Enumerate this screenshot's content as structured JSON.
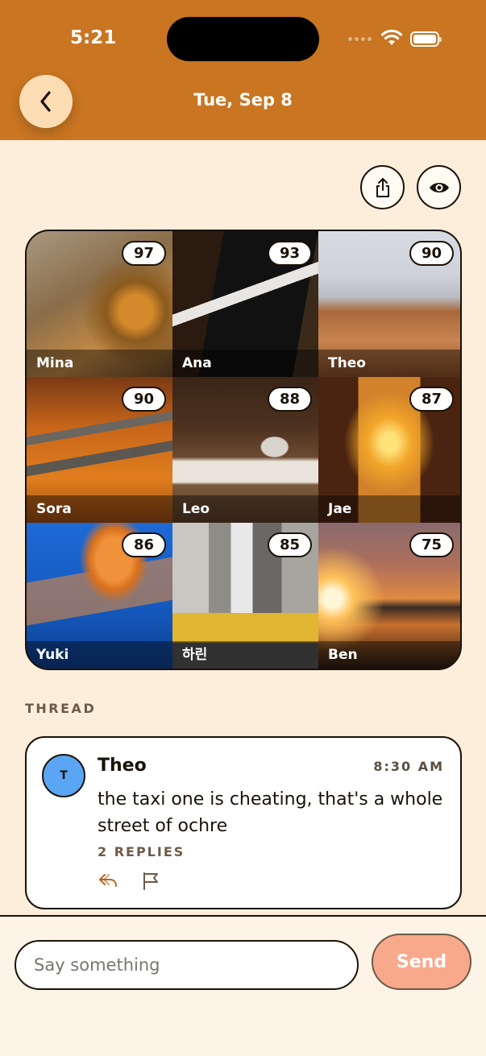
{
  "status_bar": {
    "time": "5:21"
  },
  "header": {
    "title": "Tue, Sep 8"
  },
  "actions": {
    "share_icon": "share-icon",
    "eye_icon": "eye-icon"
  },
  "grid": [
    {
      "name": "Mina",
      "score": "97",
      "photo": "cactus-spines"
    },
    {
      "name": "Ana",
      "score": "93",
      "photo": "laptop"
    },
    {
      "name": "Theo",
      "score": "90",
      "photo": "glasses-on-laptop"
    },
    {
      "name": "Sora",
      "score": "90",
      "photo": "autumn-benches"
    },
    {
      "name": "Leo",
      "score": "88",
      "photo": "desk-writing"
    },
    {
      "name": "Jae",
      "score": "87",
      "photo": "sunset-street"
    },
    {
      "name": "Yuki",
      "score": "86",
      "photo": "jellyfish"
    },
    {
      "name": "하린",
      "score": "85",
      "photo": "city-taxis"
    },
    {
      "name": "Ben",
      "score": "75",
      "photo": "sunset-sea"
    }
  ],
  "thread": {
    "label": "THREAD",
    "post": {
      "avatar_initial": "T",
      "author": "Theo",
      "time": "8:30 AM",
      "message": "the taxi one is cheating, that's a whole street of ochre",
      "replies": "2 REPLIES"
    }
  },
  "composer": {
    "placeholder": "Say something",
    "send_label": "Send"
  },
  "colors": {
    "header": "#c97522",
    "background": "#fdeedb",
    "send": "#f9a98b",
    "avatar": "#5aa6f5"
  }
}
